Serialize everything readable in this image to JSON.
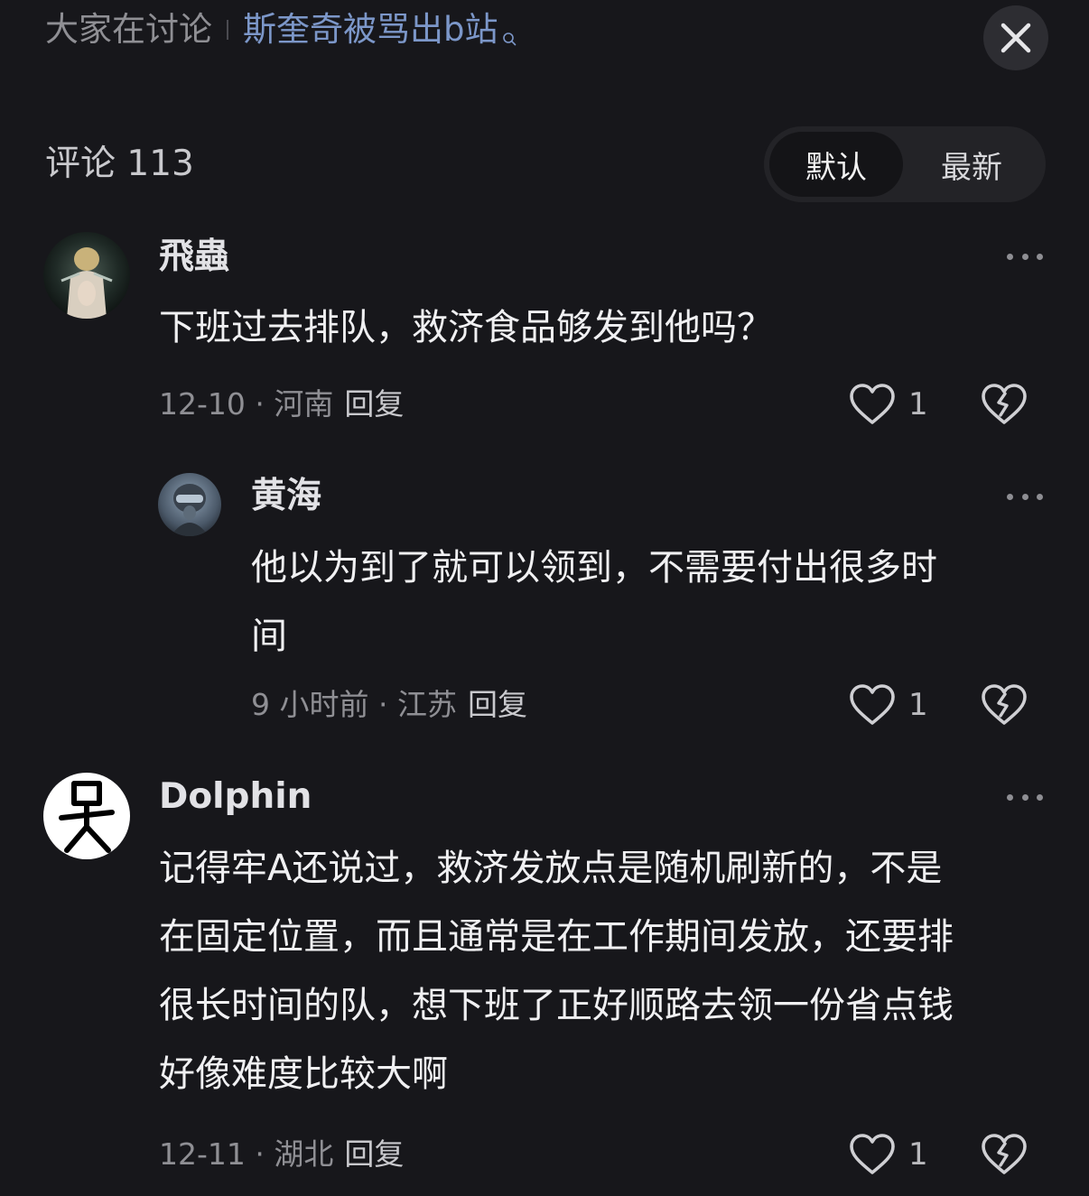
{
  "header": {
    "discuss_label": "大家在讨论",
    "topic": "斯奎奇被骂出b站"
  },
  "comments_header": {
    "count_label": "评论 113",
    "sort_default": "默认",
    "sort_latest": "最新"
  },
  "comments": [
    {
      "username": "飛蟲",
      "content_lines": [
        "下班过去排队，救济食品够发到他吗？"
      ],
      "time": "12-10",
      "dot": "·",
      "location": "河南",
      "reply_label": "回复",
      "likes": "1"
    },
    {
      "username": "黄海",
      "content_lines": [
        "他以为到了就可以领到，不需要付出很多时",
        "间"
      ],
      "time": "9 小时前",
      "dot": "·",
      "location": "江苏",
      "reply_label": "回复",
      "likes": "1"
    },
    {
      "username": "Dolphin",
      "content_lines": [
        "记得牢A还说过，救济发放点是随机刷新的，不是",
        "在固定位置，而且通常是在工作期间发放，还要排",
        "很长时间的队，想下班了正好顺路去领一份省点钱",
        "好像难度比较大啊"
      ],
      "time": "12-11",
      "dot": "·",
      "location": "湖北",
      "reply_label": "回复",
      "likes": "1"
    }
  ],
  "icons": {
    "close": "close-icon",
    "search": "search-icon",
    "more": "more-dots-icon",
    "like": "heart-icon",
    "dislike": "broken-heart-icon"
  }
}
